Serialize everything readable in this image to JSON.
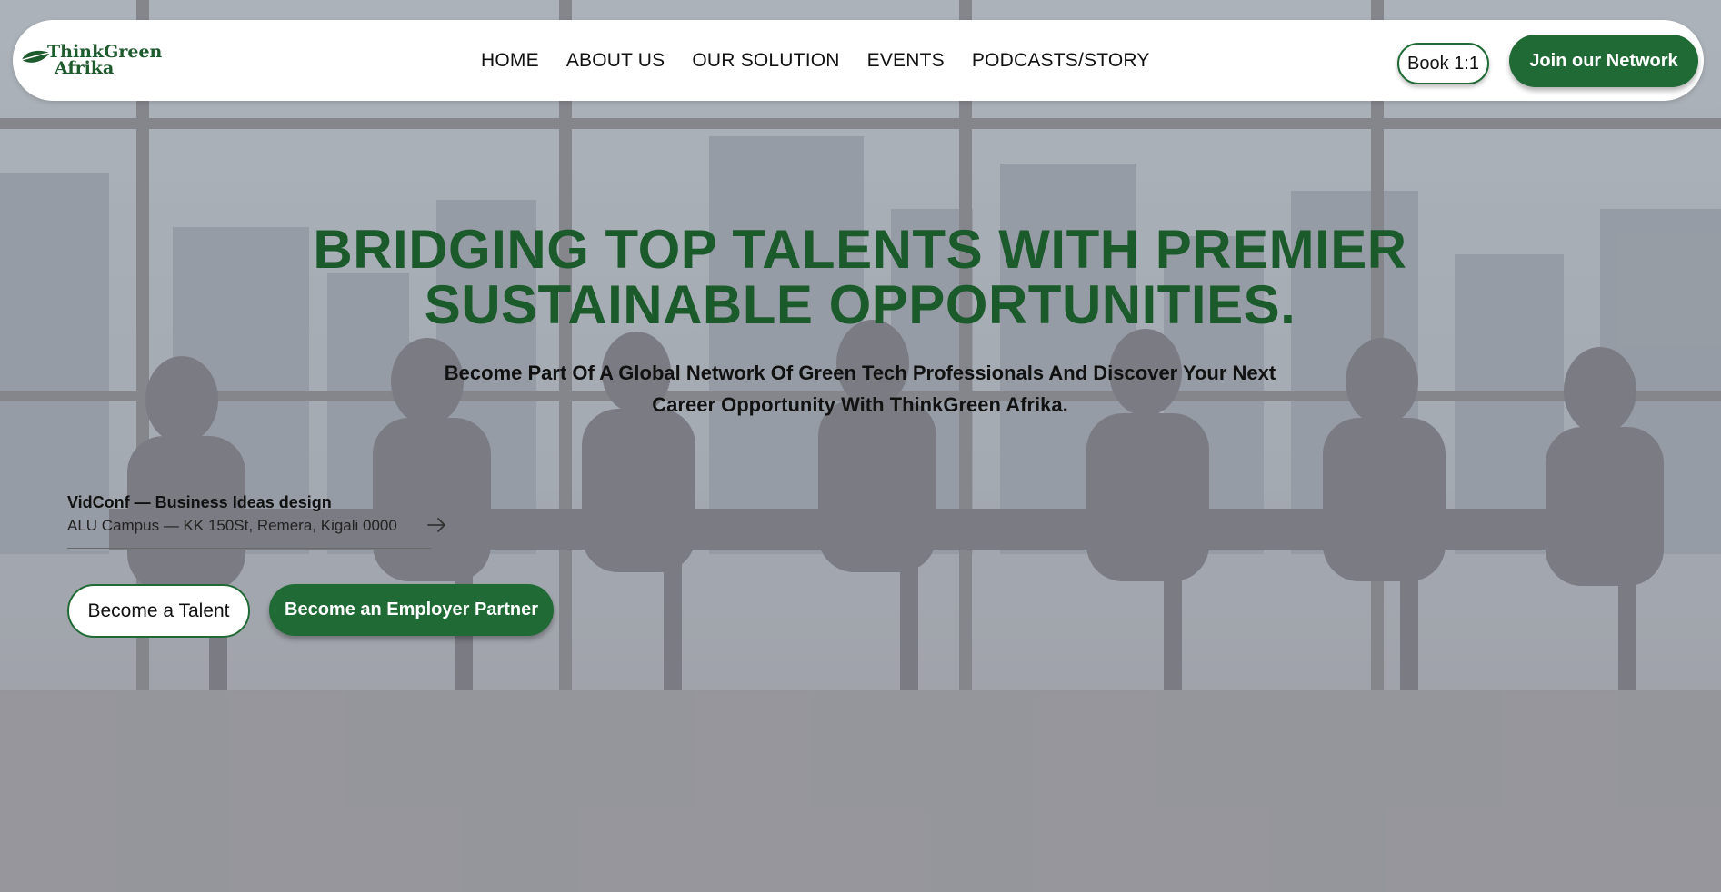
{
  "brand": {
    "logo_line1": "ThinkGreen",
    "logo_line2": "Afrika"
  },
  "nav": {
    "items": [
      {
        "label": "HOME"
      },
      {
        "label": "ABOUT US"
      },
      {
        "label": "OUR SOLUTION"
      },
      {
        "label": "EVENTS"
      },
      {
        "label": "PODCASTS/STORY"
      }
    ],
    "book_label": "Book 1:1",
    "join_label": "Join our Network"
  },
  "hero": {
    "title_line1": "BRIDGING TOP TALENTS WITH PREMIER",
    "title_line2": "SUSTAINABLE OPPORTUNITIES.",
    "subtitle_line1": "Become Part Of A Global Network Of Green Tech Professionals And Discover Your Next",
    "subtitle_line2": "Career Opportunity With ThinkGreen Afrika."
  },
  "event": {
    "title": "VidConf — Business Ideas design",
    "location": "ALU Campus — KK 150St, Remera, Kigali 0000",
    "arrow_icon": "arrow-right-icon"
  },
  "cta": {
    "talent_label": "Become a Talent",
    "employer_label": "Become an Employer Partner"
  },
  "colors": {
    "brand_green": "#1f6a35",
    "title_green": "#1b5a2b",
    "nav_bg": "#ffffff"
  }
}
